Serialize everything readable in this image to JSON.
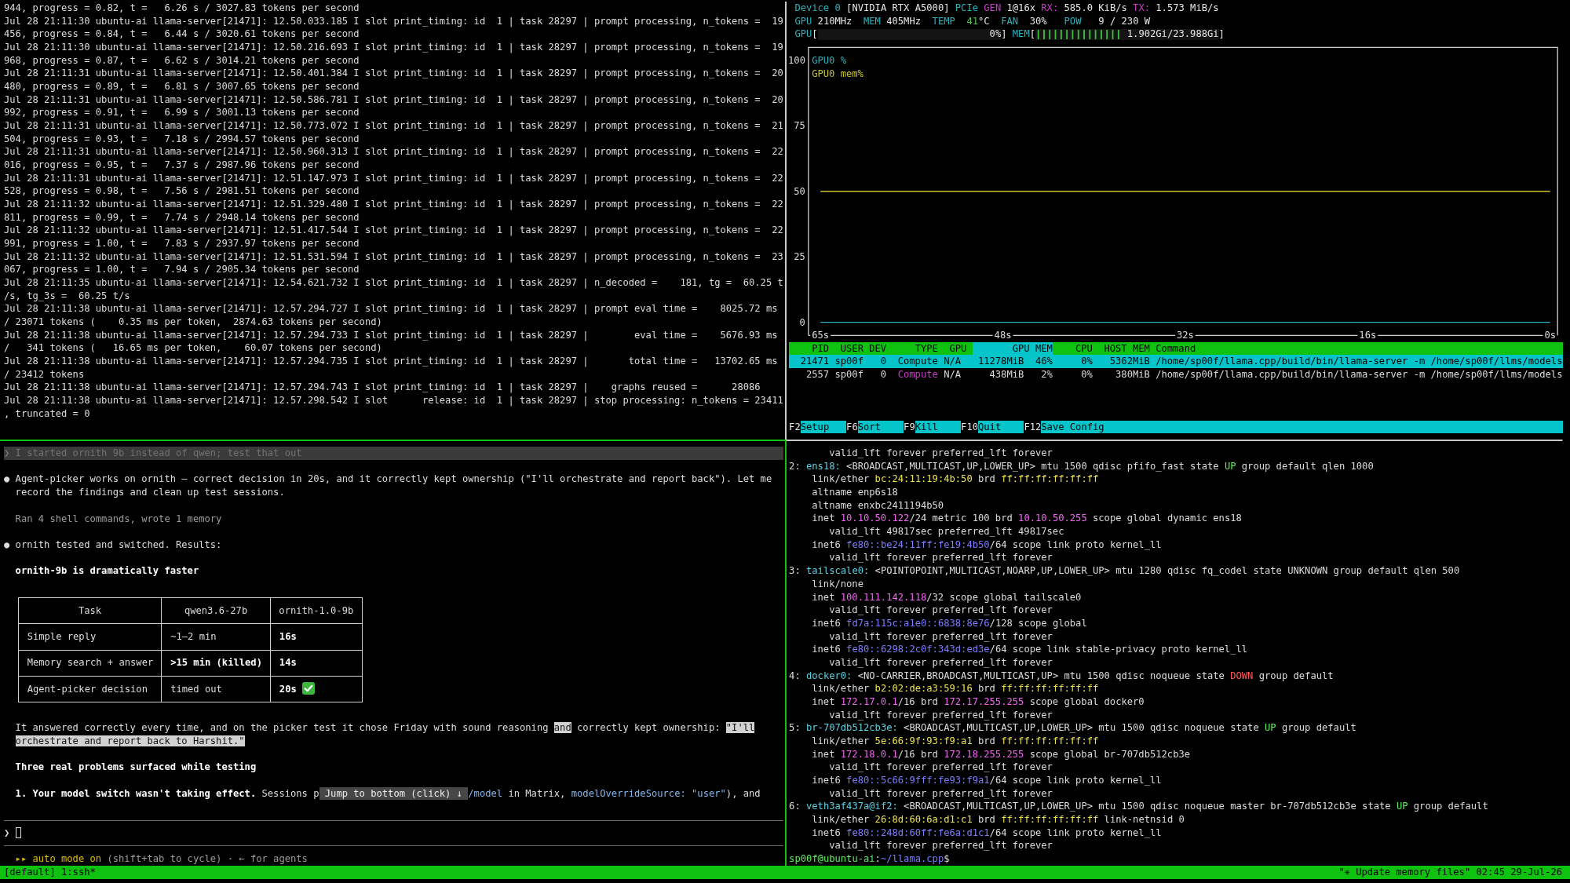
{
  "server_log": {
    "lines": [
      "944, progress = 0.82, t =   6.26 s / 3027.83 tokens per second",
      "Jul 28 21:11:30 ubuntu-ai llama-server[21471]: 12.50.033.185 I slot print_timing: id  1 | task 28297 | prompt processing, n_tokens =  19",
      "456, progress = 0.84, t =   6.44 s / 3020.61 tokens per second",
      "Jul 28 21:11:30 ubuntu-ai llama-server[21471]: 12.50.216.693 I slot print_timing: id  1 | task 28297 | prompt processing, n_tokens =  19",
      "968, progress = 0.87, t =   6.62 s / 3014.21 tokens per second",
      "Jul 28 21:11:31 ubuntu-ai llama-server[21471]: 12.50.401.384 I slot print_timing: id  1 | task 28297 | prompt processing, n_tokens =  20",
      "480, progress = 0.89, t =   6.81 s / 3007.65 tokens per second",
      "Jul 28 21:11:31 ubuntu-ai llama-server[21471]: 12.50.586.781 I slot print_timing: id  1 | task 28297 | prompt processing, n_tokens =  20",
      "992, progress = 0.91, t =   6.99 s / 3001.13 tokens per second",
      "Jul 28 21:11:31 ubuntu-ai llama-server[21471]: 12.50.773.072 I slot print_timing: id  1 | task 28297 | prompt processing, n_tokens =  21",
      "504, progress = 0.93, t =   7.18 s / 2994.57 tokens per second",
      "Jul 28 21:11:31 ubuntu-ai llama-server[21471]: 12.50.960.313 I slot print_timing: id  1 | task 28297 | prompt processing, n_tokens =  22",
      "016, progress = 0.95, t =   7.37 s / 2987.96 tokens per second",
      "Jul 28 21:11:31 ubuntu-ai llama-server[21471]: 12.51.147.973 I slot print_timing: id  1 | task 28297 | prompt processing, n_tokens =  22",
      "528, progress = 0.98, t =   7.56 s / 2981.51 tokens per second",
      "Jul 28 21:11:32 ubuntu-ai llama-server[21471]: 12.51.329.480 I slot print_timing: id  1 | task 28297 | prompt processing, n_tokens =  22",
      "811, progress = 0.99, t =   7.74 s / 2948.14 tokens per second",
      "Jul 28 21:11:32 ubuntu-ai llama-server[21471]: 12.51.417.544 I slot print_timing: id  1 | task 28297 | prompt processing, n_tokens =  22",
      "991, progress = 1.00, t =   7.83 s / 2937.97 tokens per second",
      "Jul 28 21:11:32 ubuntu-ai llama-server[21471]: 12.51.531.594 I slot print_timing: id  1 | task 28297 | prompt processing, n_tokens =  23",
      "067, progress = 1.00, t =   7.94 s / 2905.34 tokens per second",
      "Jul 28 21:11:35 ubuntu-ai llama-server[21471]: 12.54.621.732 I slot print_timing: id  1 | task 28297 | n_decoded =    181, tg =  60.25 t",
      "/s, tg_3s =  60.25 t/s",
      "Jul 28 21:11:38 ubuntu-ai llama-server[21471]: 12.57.294.727 I slot print_timing: id  1 | task 28297 | prompt eval time =    8025.72 ms",
      "/ 23071 tokens (    0.35 ms per token,  2874.63 tokens per second)",
      "Jul 28 21:11:38 ubuntu-ai llama-server[21471]: 12.57.294.733 I slot print_timing: id  1 | task 28297 |        eval time =    5676.93 ms",
      "/   341 tokens (   16.65 ms per token,    60.07 tokens per second)",
      "Jul 28 21:11:38 ubuntu-ai llama-server[21471]: 12.57.294.735 I slot print_timing: id  1 | task 28297 |       total time =   13702.65 ms",
      "/ 23412 tokens",
      "Jul 28 21:11:38 ubuntu-ai llama-server[21471]: 12.57.294.743 I slot print_timing: id  1 | task 28297 |    graphs reused =      28086",
      "Jul 28 21:11:38 ubuntu-ai llama-server[21471]: 12.57.298.542 I slot      release: id  1 | task 28297 | stop processing: n_tokens = 23411",
      ", truncated = 0"
    ]
  },
  "gpu_monitor": {
    "device_line": [
      {
        "kind": "label",
        "text": "Device 0"
      },
      {
        "kind": "value",
        "text": " [NVIDIA RTX A5000] "
      },
      {
        "kind": "label",
        "text": "PCIe "
      },
      {
        "kind": "key",
        "text": "GEN"
      },
      {
        "kind": "value",
        "text": " 1@16x "
      },
      {
        "kind": "key",
        "text": "RX:"
      },
      {
        "kind": "value",
        "text": " 585.0 KiB/s "
      },
      {
        "kind": "key",
        "text": "TX:"
      },
      {
        "kind": "value",
        "text": " 1.573 MiB/s"
      }
    ],
    "stats_line": [
      {
        "kind": "label",
        "text": "GPU"
      },
      {
        "kind": "value",
        "text": " 210MHz  "
      },
      {
        "kind": "label",
        "text": "MEM"
      },
      {
        "kind": "value",
        "text": " 405MHz  "
      },
      {
        "kind": "label",
        "text": "TEMP  "
      },
      {
        "kind": "good",
        "text": "41"
      },
      {
        "kind": "value",
        "text": "°C  "
      },
      {
        "kind": "label",
        "text": "FAN"
      },
      {
        "kind": "value",
        "text": "  30%   "
      },
      {
        "kind": "label",
        "text": "POW"
      },
      {
        "kind": "value",
        "text": "   9 / 230 W"
      }
    ],
    "gauges": [
      {
        "label": "GPU",
        "open": "[",
        "reading": "0%",
        "close": "]"
      },
      {
        "label": "MEM",
        "open": "[",
        "level": 0.46,
        "reading": "1.902Gi/23.988Gi",
        "close": "]"
      }
    ],
    "chart_data": {
      "type": "line",
      "categories": [
        "65s",
        "48s",
        "32s",
        "16s",
        "0s"
      ],
      "ylim": [
        -5,
        105
      ],
      "yticks": [
        0,
        25,
        50,
        75,
        100
      ],
      "series": [
        {
          "name": "GPU0 %",
          "color": "#2ab3bd",
          "values": [
            0,
            0,
            0,
            0,
            0
          ]
        },
        {
          "name": "GPU0 mem%",
          "color": "#c9c42a",
          "values": [
            50,
            50,
            50,
            50,
            50
          ]
        }
      ]
    },
    "process_table": {
      "columns": [
        {
          "label": "PID",
          "kind": "number",
          "selected": false
        },
        {
          "label": "USER",
          "kind": "name",
          "selected": false
        },
        {
          "label": "DEV",
          "kind": "number",
          "selected": false
        },
        {
          "label": "TYPE",
          "kind": "type",
          "selected": false
        },
        {
          "label": "GPU",
          "kind": "flag",
          "selected": false
        },
        {
          "label": "GPU MEM",
          "kind": "number",
          "selected": true
        },
        {
          "label": "CPU",
          "kind": "number",
          "selected": false
        },
        {
          "label": "HOST MEM",
          "kind": "number",
          "selected": false
        },
        {
          "label": "Command",
          "kind": "path",
          "selected": false
        }
      ],
      "rows": [
        {
          "selected": true,
          "cells": [
            "21471",
            "sp00f",
            "0",
            "Compute",
            "N/A",
            "11278MiB  46%",
            "0%",
            "5362MiB",
            "/home/sp00f/llama.cpp/build/bin/llama-server -m /home/sp00f/llms/models"
          ]
        },
        {
          "selected": false,
          "cells": [
            "2557",
            "sp00f",
            "0",
            "Compute",
            "N/A",
            "438MiB   2%",
            "0%",
            "380MiB",
            "/home/sp00f/llama.cpp/build/bin/llama-server -m /home/sp00f/llms/models"
          ]
        }
      ]
    },
    "function_keys": [
      {
        "key": "F2",
        "label": "Setup"
      },
      {
        "key": "F6",
        "label": "Sort"
      },
      {
        "key": "F9",
        "label": "Kill"
      },
      {
        "key": "F10",
        "label": "Quit"
      },
      {
        "key": "F12",
        "label": "Save Config"
      }
    ]
  },
  "assistant": {
    "submitted_prompt": {
      "marker": "❯",
      "text": "I started ornith 9b instead of qwen; test that out"
    },
    "blocks": [
      {
        "kind": "bullet",
        "marker": "●",
        "text": "Agent-picker works on ornith — correct decision in 20s, and it correctly kept ownership (\"I'll orchestrate and report back\"). Let me record the findings and clean up test sessions."
      },
      {
        "kind": "note",
        "text": "Ran 4 shell commands, wrote 1 memory"
      },
      {
        "kind": "bullet",
        "marker": "●",
        "text": "ornith tested and switched. Results:"
      },
      {
        "kind": "heading",
        "text": "ornith-9b is dramatically faster"
      },
      {
        "kind": "table",
        "columns": [
          "Task",
          "qwen3.6-27b",
          "ornith-1.0-9b"
        ],
        "rows": [
          [
            {
              "text": "Simple reply",
              "strong": false,
              "check_mark": false
            },
            {
              "text": "~1–2 min",
              "strong": false,
              "check_mark": false
            },
            {
              "text": "16s",
              "strong": true,
              "check_mark": false
            }
          ],
          [
            {
              "text": "Memory search + answer",
              "strong": false,
              "check_mark": false
            },
            {
              "text": ">15 min (killed)",
              "strong": true,
              "check_mark": false
            },
            {
              "text": "14s",
              "strong": true,
              "check_mark": false
            }
          ],
          [
            {
              "text": "Agent-picker decision",
              "strong": false,
              "check_mark": false
            },
            {
              "text": "timed out",
              "strong": false,
              "check_mark": false
            },
            {
              "text": "20s",
              "strong": true,
              "check_mark": true
            }
          ]
        ]
      },
      {
        "kind": "paragraph",
        "spans": [
          {
            "kind": "plain",
            "text": "It answered correctly every time, and on the picker test it chose Friday with sound reasoning "
          },
          {
            "kind": "highlight",
            "text": "and"
          },
          {
            "kind": "plain",
            "text": " correctly kept ownership: "
          },
          {
            "kind": "highlight",
            "text": "\"I'll orchestrate and report back to Harshit.\""
          }
        ]
      },
      {
        "kind": "heading",
        "text": "Three real problems surfaced while testing"
      },
      {
        "kind": "item",
        "lead": "**1. Your model switch wasn't taking effect.** Sessions p",
        "overlay_button": "Jump to bottom (click) ↓",
        "tail": [
          {
            "kind": "code",
            "text": "/model"
          },
          {
            "kind": "plain",
            "text": " in Matrix, "
          },
          {
            "kind": "code",
            "text": "modelOverrideSource: \"user\""
          },
          {
            "kind": "plain",
            "text": "), and"
          }
        ]
      }
    ],
    "input": {
      "marker": "❯"
    },
    "mode_line": [
      {
        "kind": "accent",
        "text": "▸▸ auto mode on"
      },
      {
        "kind": "dim",
        "text": " (shift+tab to cycle) · ← for agents"
      }
    ]
  },
  "shell": {
    "lines": [
      {
        "children": [
          {
            "children": [
              {
                "text": "valid_lft forever preferred_lft forever"
              }
            ]
          }
        ]
      },
      {
        "spans": [
          {
            "kind": "plain",
            "text": "2: "
          },
          {
            "kind": "iface",
            "text": "ens18:"
          },
          {
            "kind": "plain",
            "text": " <BROADCAST,MULTICAST,UP,LOWER_UP> mtu 1500 qdisc pfifo_fast state "
          },
          {
            "kind": "up",
            "text": "UP"
          },
          {
            "kind": "plain",
            "text": " group default qlen 1000"
          }
        ],
        "children": [
          {
            "spans": [
              {
                "kind": "plain",
                "text": "link/ether "
              },
              {
                "kind": "mac",
                "text": "bc:24:11:19:4b:50"
              },
              {
                "kind": "plain",
                "text": " brd "
              },
              {
                "kind": "mac",
                "text": "ff:ff:ff:ff:ff:ff"
              }
            ]
          },
          {
            "text": "altname enp6s18"
          },
          {
            "text": "altname enxbc2411194b50"
          },
          {
            "spans": [
              {
                "kind": "plain",
                "text": "inet "
              },
              {
                "kind": "ipv4",
                "text": "10.10.50.122"
              },
              {
                "kind": "plain",
                "text": "/24 metric 100 brd "
              },
              {
                "kind": "ipv4",
                "text": "10.10.50.255"
              },
              {
                "kind": "plain",
                "text": " scope global dynamic ens18"
              }
            ],
            "children": [
              {
                "text": "valid_lft 49817sec preferred_lft 49817sec"
              }
            ]
          },
          {
            "spans": [
              {
                "kind": "plain",
                "text": "inet6 "
              },
              {
                "kind": "ipv6",
                "text": "fe80::be24:11ff:fe19:4b50"
              },
              {
                "kind": "plain",
                "text": "/64 scope link proto kernel_ll"
              }
            ],
            "children": [
              {
                "text": "valid_lft forever preferred_lft forever"
              }
            ]
          }
        ]
      },
      {
        "spans": [
          {
            "kind": "plain",
            "text": "3: "
          },
          {
            "kind": "iface",
            "text": "tailscale0:"
          },
          {
            "kind": "plain",
            "text": " <POINTOPOINT,MULTICAST,NOARP,UP,LOWER_UP> mtu 1280 qdisc fq_codel state UNKNOWN group default qlen 500"
          }
        ],
        "children": [
          {
            "text": "link/none"
          },
          {
            "spans": [
              {
                "kind": "plain",
                "text": "inet "
              },
              {
                "kind": "ipv4",
                "text": "100.111.142.118"
              },
              {
                "kind": "plain",
                "text": "/32 scope global tailscale0"
              }
            ],
            "children": [
              {
                "text": "valid_lft forever preferred_lft forever"
              }
            ]
          },
          {
            "spans": [
              {
                "kind": "plain",
                "text": "inet6 "
              },
              {
                "kind": "ipv6",
                "text": "fd7a:115c:a1e0::6838:8e76"
              },
              {
                "kind": "plain",
                "text": "/128 scope global"
              }
            ],
            "children": [
              {
                "text": "valid_lft forever preferred_lft forever"
              }
            ]
          },
          {
            "spans": [
              {
                "kind": "plain",
                "text": "inet6 "
              },
              {
                "kind": "ipv6",
                "text": "fe80::6298:2c0f:343d:ed3e"
              },
              {
                "kind": "plain",
                "text": "/64 scope link stable-privacy proto kernel_ll"
              }
            ],
            "children": [
              {
                "text": "valid_lft forever preferred_lft forever"
              }
            ]
          }
        ]
      },
      {
        "spans": [
          {
            "kind": "plain",
            "text": "4: "
          },
          {
            "kind": "iface",
            "text": "docker0:"
          },
          {
            "kind": "plain",
            "text": " <NO-CARRIER,BROADCAST,MULTICAST,UP> mtu 1500 qdisc noqueue state "
          },
          {
            "kind": "down",
            "text": "DOWN"
          },
          {
            "kind": "plain",
            "text": " group default"
          }
        ],
        "children": [
          {
            "spans": [
              {
                "kind": "plain",
                "text": "link/ether "
              },
              {
                "kind": "mac",
                "text": "b2:02:de:a3:59:16"
              },
              {
                "kind": "plain",
                "text": " brd "
              },
              {
                "kind": "mac",
                "text": "ff:ff:ff:ff:ff:ff"
              }
            ]
          },
          {
            "spans": [
              {
                "kind": "plain",
                "text": "inet "
              },
              {
                "kind": "ipv4",
                "text": "172.17.0.1"
              },
              {
                "kind": "plain",
                "text": "/16 brd "
              },
              {
                "kind": "ipv4",
                "text": "172.17.255.255"
              },
              {
                "kind": "plain",
                "text": " scope global docker0"
              }
            ],
            "children": [
              {
                "text": "valid_lft forever preferred_lft forever"
              }
            ]
          }
        ]
      },
      {
        "spans": [
          {
            "kind": "plain",
            "text": "5: "
          },
          {
            "kind": "iface",
            "text": "br-707db512cb3e:"
          },
          {
            "kind": "plain",
            "text": " <BROADCAST,MULTICAST,UP,LOWER_UP> mtu 1500 qdisc noqueue state "
          },
          {
            "kind": "up",
            "text": "UP"
          },
          {
            "kind": "plain",
            "text": " group default"
          }
        ],
        "children": [
          {
            "spans": [
              {
                "kind": "plain",
                "text": "link/ether "
              },
              {
                "kind": "mac",
                "text": "5e:66:9f:93:f9:a1"
              },
              {
                "kind": "plain",
                "text": " brd "
              },
              {
                "kind": "mac",
                "text": "ff:ff:ff:ff:ff:ff"
              }
            ]
          },
          {
            "spans": [
              {
                "kind": "plain",
                "text": "inet "
              },
              {
                "kind": "ipv4",
                "text": "172.18.0.1"
              },
              {
                "kind": "plain",
                "text": "/16 brd "
              },
              {
                "kind": "ipv4",
                "text": "172.18.255.255"
              },
              {
                "kind": "plain",
                "text": " scope global br-707db512cb3e"
              }
            ],
            "children": [
              {
                "text": "valid_lft forever preferred_lft forever"
              }
            ]
          },
          {
            "spans": [
              {
                "kind": "plain",
                "text": "inet6 "
              },
              {
                "kind": "ipv6",
                "text": "fe80::5c66:9fff:fe93:f9a1"
              },
              {
                "kind": "plain",
                "text": "/64 scope link proto kernel_ll"
              }
            ],
            "children": [
              {
                "text": "valid_lft forever preferred_lft forever"
              }
            ]
          }
        ]
      },
      {
        "spans": [
          {
            "kind": "plain",
            "text": "6: "
          },
          {
            "kind": "iface",
            "text": "veth3af437a@if2:"
          },
          {
            "kind": "plain",
            "text": " <BROADCAST,MULTICAST,UP,LOWER_UP> mtu 1500 qdisc noqueue master br-707db512cb3e state "
          },
          {
            "kind": "up",
            "text": "UP"
          },
          {
            "kind": "plain",
            "text": " group default"
          }
        ],
        "children": [
          {
            "spans": [
              {
                "kind": "plain",
                "text": "link/ether "
              },
              {
                "kind": "mac",
                "text": "26:8d:60:6a:d1:c1"
              },
              {
                "kind": "plain",
                "text": " brd "
              },
              {
                "kind": "mac",
                "text": "ff:ff:ff:ff:ff:ff"
              },
              {
                "kind": "plain",
                "text": " link-netnsid 0"
              }
            ]
          },
          {
            "spans": [
              {
                "kind": "plain",
                "text": "inet6 "
              },
              {
                "kind": "ipv6",
                "text": "fe80::248d:60ff:fe6a:d1c1"
              },
              {
                "kind": "plain",
                "text": "/64 scope link proto kernel_ll"
              }
            ],
            "children": [
              {
                "text": "valid_lft forever preferred_lft forever"
              }
            ]
          }
        ]
      }
    ],
    "prompt": [
      {
        "kind": "user",
        "text": "sp00f@ubuntu-ai"
      },
      {
        "kind": "plain",
        "text": ":"
      },
      {
        "kind": "path",
        "text": "~/llama.cpp"
      },
      {
        "kind": "plain",
        "text": "$"
      }
    ]
  },
  "status_bar": {
    "session": "[default] 1:ssh*",
    "pane_title": "\"✳ Update memory files\"",
    "clock": "02:45 29-Jul-26"
  }
}
